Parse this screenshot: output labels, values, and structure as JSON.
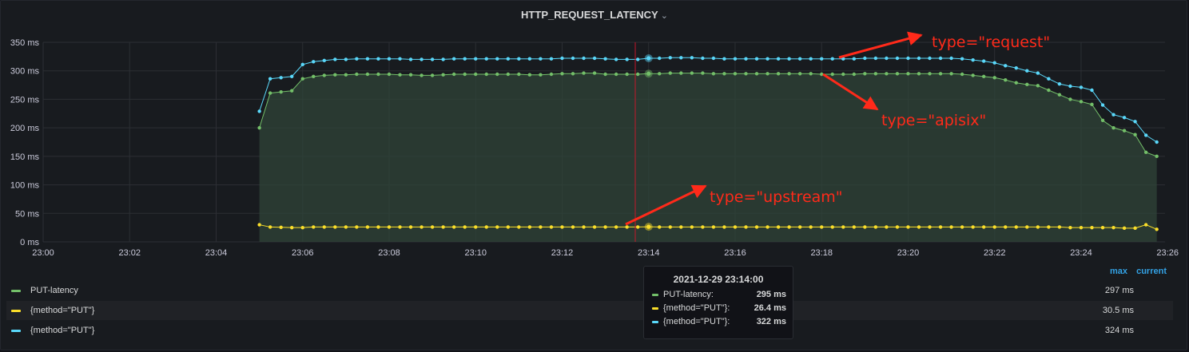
{
  "panel": {
    "title": "HTTP_REQUEST_LATENCY",
    "title_icon": "chevron-down-icon"
  },
  "colors": {
    "green": "#73bf69",
    "yellow": "#fade2a",
    "cyan": "#5ad8fa",
    "grid": "#2c2f34",
    "axis_text": "#ccccdc",
    "cursor": "#c4162a",
    "arrow": "#ff2a1a",
    "fill": "#2f4438"
  },
  "chart_data": {
    "type": "line",
    "title": "HTTP_REQUEST_LATENCY",
    "y_unit": "ms",
    "ylim": [
      0,
      350
    ],
    "y_ticks": [
      0,
      50,
      100,
      150,
      200,
      250,
      300,
      350
    ],
    "y_tick_labels": [
      "0 ms",
      "50 ms",
      "100 ms",
      "150 ms",
      "200 ms",
      "250 ms",
      "300 ms",
      "350 ms"
    ],
    "x_range": [
      "23:00",
      "23:26"
    ],
    "x_ticks": [
      "23:00",
      "23:02",
      "23:04",
      "23:06",
      "23:08",
      "23:10",
      "23:12",
      "23:14",
      "23:16",
      "23:18",
      "23:20",
      "23:22",
      "23:24",
      "23:26"
    ],
    "grid": true,
    "legend_placement": "bottom",
    "x": [
      "23:05:00",
      "23:05:15",
      "23:05:30",
      "23:05:45",
      "23:06:00",
      "23:06:15",
      "23:06:30",
      "23:06:45",
      "23:07:00",
      "23:07:15",
      "23:07:30",
      "23:07:45",
      "23:08:00",
      "23:08:15",
      "23:08:30",
      "23:08:45",
      "23:09:00",
      "23:09:15",
      "23:09:30",
      "23:09:45",
      "23:10:00",
      "23:10:15",
      "23:10:30",
      "23:10:45",
      "23:11:00",
      "23:11:15",
      "23:11:30",
      "23:11:45",
      "23:12:00",
      "23:12:15",
      "23:12:30",
      "23:12:45",
      "23:13:00",
      "23:13:15",
      "23:13:30",
      "23:13:45",
      "23:14:00",
      "23:14:15",
      "23:14:30",
      "23:14:45",
      "23:15:00",
      "23:15:15",
      "23:15:30",
      "23:15:45",
      "23:16:00",
      "23:16:15",
      "23:16:30",
      "23:16:45",
      "23:17:00",
      "23:17:15",
      "23:17:30",
      "23:17:45",
      "23:18:00",
      "23:18:15",
      "23:18:30",
      "23:18:45",
      "23:19:00",
      "23:19:15",
      "23:19:30",
      "23:19:45",
      "23:20:00",
      "23:20:15",
      "23:20:30",
      "23:20:45",
      "23:21:00",
      "23:21:15",
      "23:21:30",
      "23:21:45",
      "23:22:00",
      "23:22:15",
      "23:22:30",
      "23:22:45",
      "23:23:00",
      "23:23:15",
      "23:23:30",
      "23:23:45",
      "23:24:00",
      "23:24:15",
      "23:24:30",
      "23:24:45",
      "23:25:00",
      "23:25:15",
      "23:25:30",
      "23:25:45"
    ],
    "series": [
      {
        "name": "PUT-latency",
        "color": "#73bf69",
        "filled": true,
        "values": [
          200,
          261,
          263,
          265,
          286,
          290,
          292,
          293,
          293,
          294,
          294,
          294,
          294,
          293,
          293,
          292,
          292,
          293,
          294,
          294,
          294,
          294,
          294,
          294,
          294,
          293,
          293,
          294,
          295,
          295,
          296,
          296,
          294,
          294,
          294,
          294,
          295,
          295,
          296,
          296,
          296,
          296,
          295,
          295,
          295,
          295,
          295,
          295,
          295,
          295,
          295,
          295,
          294,
          294,
          294,
          294,
          295,
          295,
          295,
          295,
          295,
          295,
          295,
          295,
          295,
          294,
          292,
          290,
          288,
          284,
          279,
          276,
          274,
          266,
          258,
          250,
          246,
          241,
          213,
          200,
          195,
          188,
          157,
          150
        ]
      },
      {
        "name": "{method=\"PUT\"}",
        "color": "#fade2a",
        "filled": false,
        "values": [
          30,
          26,
          25.5,
          25,
          25,
          26,
          26,
          26,
          26,
          26,
          26,
          26,
          26,
          26,
          26,
          26,
          26,
          26,
          26,
          26,
          26,
          26,
          26,
          26,
          26,
          26,
          26,
          26,
          26,
          26,
          26,
          26,
          26,
          26,
          26,
          26,
          26.4,
          26,
          26,
          26,
          26,
          26,
          26,
          26,
          26,
          26,
          26,
          26,
          26,
          26,
          26,
          26,
          26,
          26,
          26,
          26,
          26,
          26,
          26,
          26,
          26,
          26,
          26,
          26,
          26,
          26,
          26,
          26,
          26,
          26,
          26,
          26,
          26,
          26,
          26,
          25,
          25,
          25,
          25,
          25,
          24,
          24,
          30,
          22
        ]
      },
      {
        "name": "{method=\"PUT\"}",
        "color": "#5ad8fa",
        "filled": false,
        "values": [
          229,
          286,
          288,
          290,
          311,
          316,
          318,
          320,
          320,
          321,
          321,
          321,
          321,
          321,
          320,
          320,
          320,
          320,
          321,
          321,
          321,
          321,
          321,
          321,
          321,
          321,
          321,
          321,
          322,
          322,
          322,
          322,
          321,
          320,
          320,
          320,
          322,
          322,
          323,
          323,
          323,
          322,
          322,
          321,
          321,
          321,
          321,
          321,
          321,
          321,
          321,
          321,
          321,
          321,
          321,
          321,
          322,
          322,
          322,
          322,
          322,
          322,
          322,
          322,
          322,
          321,
          319,
          317,
          314,
          309,
          305,
          300,
          296,
          286,
          277,
          273,
          271,
          266,
          240,
          223,
          218,
          211,
          187,
          175
        ]
      }
    ],
    "hover": {
      "time": "2021-12-29 23:14:00",
      "rows": [
        {
          "name": "PUT-latency:",
          "value": "295 ms",
          "color": "#73bf69"
        },
        {
          "name": "{method=\"PUT\"}:",
          "value": "26.4 ms",
          "color": "#fade2a"
        },
        {
          "name": "{method=\"PUT\"}:",
          "value": "322 ms",
          "color": "#5ad8fa"
        }
      ]
    }
  },
  "legend": {
    "columns": [
      "max",
      "current"
    ],
    "rows": [
      {
        "name": "PUT-latency",
        "value": "297 ms",
        "color": "#73bf69"
      },
      {
        "name": "{method=\"PUT\"}",
        "value": "30.5 ms",
        "color": "#fade2a"
      },
      {
        "name": "{method=\"PUT\"}",
        "value": "324 ms",
        "color": "#5ad8fa"
      }
    ]
  },
  "annotations": [
    {
      "id": "request",
      "text": "type=\"request\""
    },
    {
      "id": "apisix",
      "text": "type=\"apisix\""
    },
    {
      "id": "upstream",
      "text": "type=\"upstream\""
    }
  ]
}
